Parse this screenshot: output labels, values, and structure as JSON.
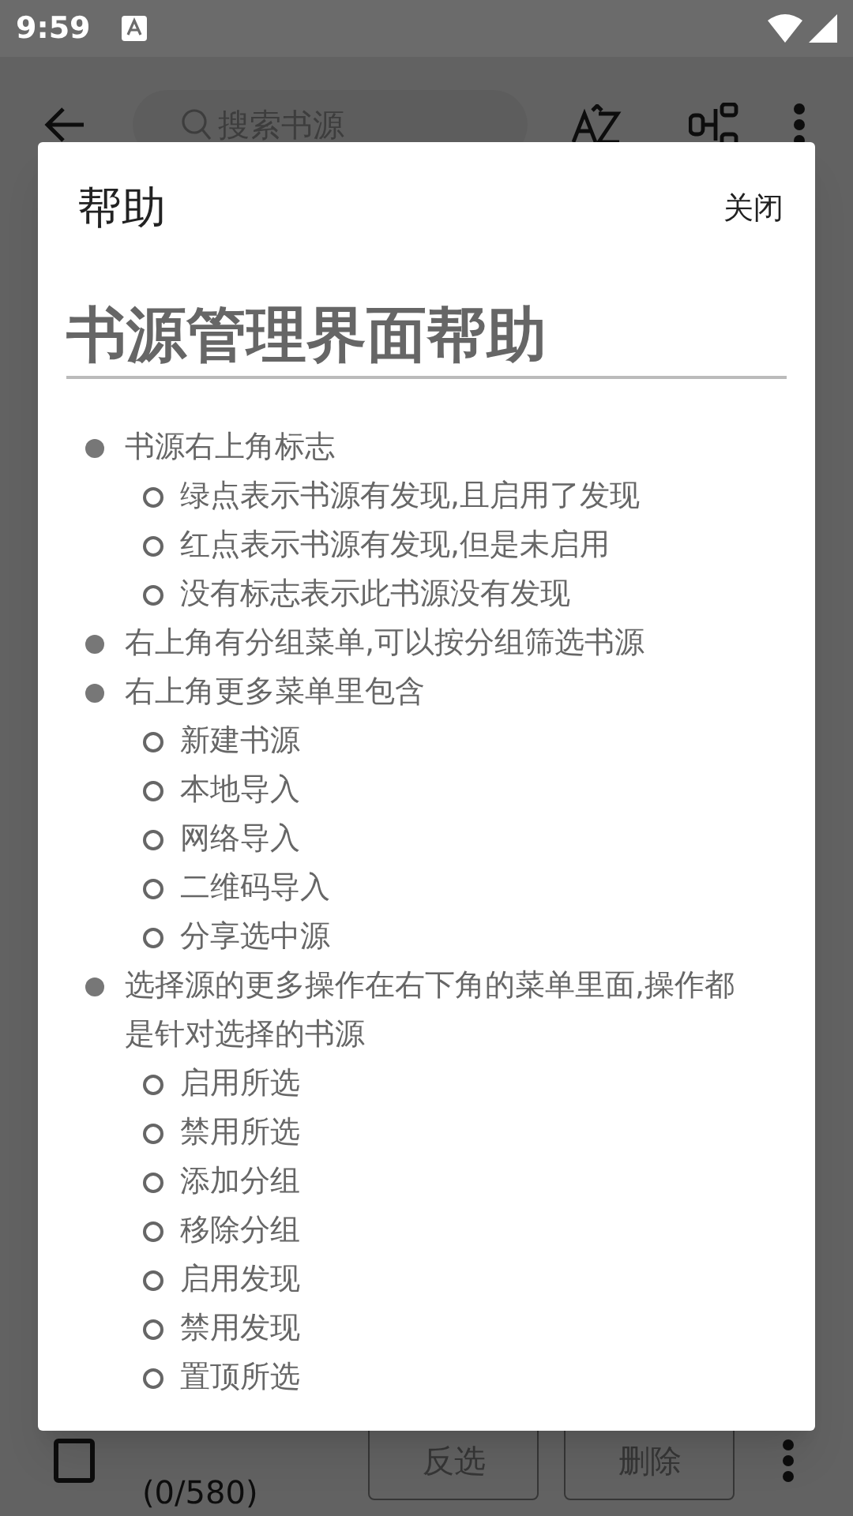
{
  "status_bar": {
    "time": "9:59"
  },
  "app_bar": {
    "search": {
      "placeholder": "搜索书源"
    }
  },
  "bottom_bar": {
    "select_all": {
      "checked": false
    },
    "count": "(0/580)",
    "buttons": [
      "反选",
      "删除"
    ]
  },
  "dialog": {
    "title": "帮助",
    "close": "关闭",
    "heading": "书源管理界面帮助",
    "items": [
      {
        "text": "书源右上角标志",
        "children": [
          {
            "text": "绿点表示书源有发现,且启用了发现"
          },
          {
            "text": "红点表示书源有发现,但是未启用"
          },
          {
            "text": "没有标志表示此书源没有发现"
          }
        ]
      },
      {
        "text": "右上角有分组菜单,可以按分组筛选书源"
      },
      {
        "text": "右上角更多菜单里包含",
        "children": [
          {
            "text": "新建书源"
          },
          {
            "text": "本地导入"
          },
          {
            "text": "网络导入"
          },
          {
            "text": "二维码导入"
          },
          {
            "text": "分享选中源"
          }
        ]
      },
      {
        "text": "选择源的更多操作在右下角的菜单里面,操作都是针对选择的书源",
        "children": [
          {
            "text": "启用所选"
          },
          {
            "text": "禁用所选"
          },
          {
            "text": "添加分组"
          },
          {
            "text": "移除分组"
          },
          {
            "text": "启用发现"
          },
          {
            "text": "禁用发现"
          },
          {
            "text": "置顶所选"
          }
        ]
      }
    ]
  }
}
